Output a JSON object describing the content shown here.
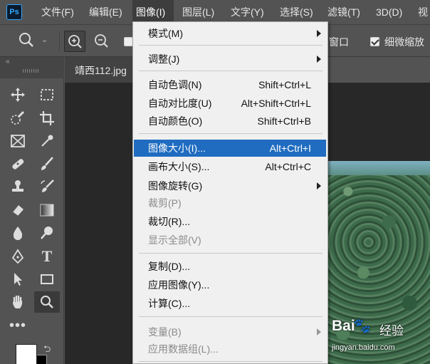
{
  "app": {
    "logo": "Ps",
    "menu": [
      "文件(F)",
      "编辑(E)",
      "图像(I)",
      "图层(L)",
      "文字(Y)",
      "选择(S)",
      "滤镜(T)",
      "3D(D)",
      "视"
    ]
  },
  "options": {
    "window_label": "窗口",
    "fine_zoom_label": "细微缩放",
    "fine_zoom_checked": true
  },
  "document": {
    "tab_title": "靖西112.jpg"
  },
  "image_menu": {
    "items": [
      {
        "label": "模式(M)",
        "shortcut": "",
        "submenu": true,
        "disabled": false
      },
      {
        "label": "调整(J)",
        "shortcut": "",
        "submenu": true,
        "disabled": false
      },
      {
        "label": "自动色调(N)",
        "shortcut": "Shift+Ctrl+L",
        "submenu": false,
        "disabled": false
      },
      {
        "label": "自动对比度(U)",
        "shortcut": "Alt+Shift+Ctrl+L",
        "submenu": false,
        "disabled": false
      },
      {
        "label": "自动颜色(O)",
        "shortcut": "Shift+Ctrl+B",
        "submenu": false,
        "disabled": false
      },
      {
        "label": "图像大小(I)...",
        "shortcut": "Alt+Ctrl+I",
        "submenu": false,
        "disabled": false,
        "highlighted": true
      },
      {
        "label": "画布大小(S)...",
        "shortcut": "Alt+Ctrl+C",
        "submenu": false,
        "disabled": false
      },
      {
        "label": "图像旋转(G)",
        "shortcut": "",
        "submenu": true,
        "disabled": false
      },
      {
        "label": "裁剪(P)",
        "shortcut": "",
        "submenu": false,
        "disabled": true
      },
      {
        "label": "裁切(R)...",
        "shortcut": "",
        "submenu": false,
        "disabled": false
      },
      {
        "label": "显示全部(V)",
        "shortcut": "",
        "submenu": false,
        "disabled": true
      },
      {
        "label": "复制(D)...",
        "shortcut": "",
        "submenu": false,
        "disabled": false
      },
      {
        "label": "应用图像(Y)...",
        "shortcut": "",
        "submenu": false,
        "disabled": false
      },
      {
        "label": "计算(C)...",
        "shortcut": "",
        "submenu": false,
        "disabled": false
      },
      {
        "label": "变量(B)",
        "shortcut": "",
        "submenu": true,
        "disabled": true
      },
      {
        "label": "应用数据组(L)...",
        "shortcut": "",
        "submenu": false,
        "disabled": true
      }
    ]
  },
  "watermark": {
    "brand": "Bai",
    "brand2": "经验",
    "url": "jingyan.baidu.com"
  },
  "colors": {
    "accent_highlight": "#1f6cc0",
    "ps_blue": "#31a8ff",
    "ui_gray": "#535353"
  }
}
